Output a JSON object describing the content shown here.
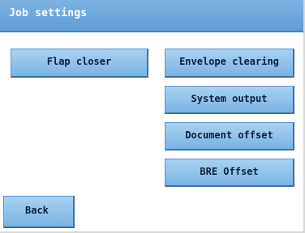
{
  "title_bar": {
    "title": "Job settings"
  },
  "buttons": {
    "flap_closer": "Flap closer",
    "envelope_clearing": "Envelope clearing",
    "system_output": "System output",
    "document_offset": "Document offset",
    "bre_offset": "BRE Offset",
    "back": "Back"
  },
  "colors": {
    "title_bar": "#6aa6dc",
    "button_fill": "#8fc2ec",
    "button_text": "#0b1f3f",
    "background": "#ffffff"
  }
}
